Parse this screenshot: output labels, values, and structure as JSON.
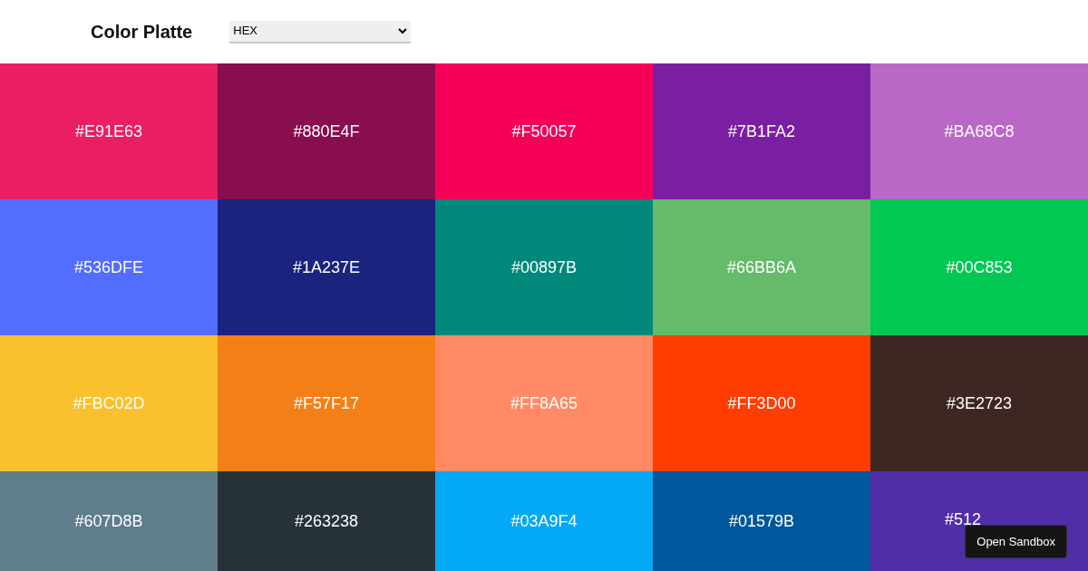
{
  "header": {
    "title": "Color Platte",
    "format_select": {
      "value": "HEX"
    }
  },
  "swatches": [
    {
      "label": "#E91E63",
      "color": "#e91e63"
    },
    {
      "label": "#880E4F",
      "color": "#880e4f"
    },
    {
      "label": "#F50057",
      "color": "#f50057"
    },
    {
      "label": "#7B1FA2",
      "color": "#7b1fa2"
    },
    {
      "label": "#BA68C8",
      "color": "#ba68c8"
    },
    {
      "label": "#536DFE",
      "color": "#536dfe"
    },
    {
      "label": "#1A237E",
      "color": "#1a237e"
    },
    {
      "label": "#00897B",
      "color": "#00897b"
    },
    {
      "label": "#66BB6A",
      "color": "#66bb6a"
    },
    {
      "label": "#00C853",
      "color": "#00c853"
    },
    {
      "label": "#FBC02D",
      "color": "#fbc02d"
    },
    {
      "label": "#F57F17",
      "color": "#f57f17"
    },
    {
      "label": "#FF8A65",
      "color": "#ff8a65"
    },
    {
      "label": "#FF3D00",
      "color": "#ff3d00"
    },
    {
      "label": "#3E2723",
      "color": "#3e2723"
    },
    {
      "label": "#607D8B",
      "color": "#607d8b"
    },
    {
      "label": "#263238",
      "color": "#263238"
    },
    {
      "label": "#03A9F4",
      "color": "#03a9f4"
    },
    {
      "label": "#01579B",
      "color": "#01579b"
    },
    {
      "label": "#512",
      "color": "#512da8",
      "kind": "covered"
    }
  ],
  "sandbox_button": {
    "label": "Open Sandbox"
  }
}
